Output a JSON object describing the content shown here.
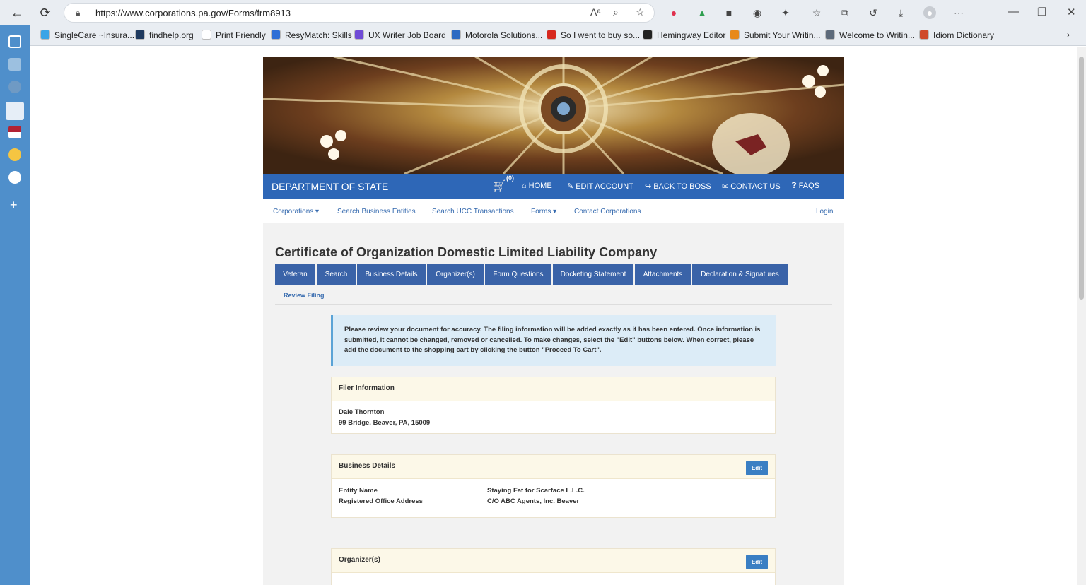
{
  "browser": {
    "url": "https://www.corporations.pa.gov/Forms/frm8913",
    "bookmarks": [
      {
        "label": "SingleCare ~Insura...",
        "color": "#3ba4e6"
      },
      {
        "label": "findhelp.org",
        "color": "#1f3a5f"
      },
      {
        "label": "Print Friendly",
        "color": "#ffffff"
      },
      {
        "label": "ResyMatch: Skills",
        "color": "#2f6fd6"
      },
      {
        "label": "UX Writer Job Board",
        "color": "#6f4bd6"
      },
      {
        "label": "Motorola Solutions...",
        "color": "#2d6ac2"
      },
      {
        "label": "So I went to buy so...",
        "color": "#d7281e"
      },
      {
        "label": "Hemingway Editor",
        "color": "#222222"
      },
      {
        "label": "Submit Your Writin...",
        "color": "#e8891a"
      },
      {
        "label": "Welcome to Writin...",
        "color": "#5d6a7a"
      },
      {
        "label": "Idiom Dictionary",
        "color": "#cf4a2a"
      }
    ]
  },
  "site": {
    "dept_title": "DEPARTMENT OF STATE",
    "cart_count": "(0)",
    "top_nav": [
      "HOME",
      "EDIT ACCOUNT",
      "BACK TO BOSS",
      "CONTACT US",
      "FAQS"
    ],
    "sub_nav": [
      "Corporations",
      "Search Business Entities",
      "Search UCC Transactions",
      "Forms",
      "Contact Corporations"
    ],
    "login": "Login"
  },
  "form": {
    "title": "Certificate of Organization Domestic Limited Liability Company",
    "tabs": [
      "Veteran",
      "Search",
      "Business Details",
      "Organizer(s)",
      "Form Questions",
      "Docketing Statement",
      "Attachments",
      "Declaration & Signatures"
    ],
    "review_tab": "Review Filing",
    "notice": "Please review your document for accuracy. The filing information will be added exactly as it has been entered. Once information is submitted, it cannot be changed, removed or cancelled. To make changes, select the \"Edit\" buttons below. When correct, please add the document to the shopping cart by clicking the button \"Proceed To Cart\".",
    "filer": {
      "header": "Filer Information",
      "name": "Dale Thornton",
      "address": "99 Bridge, Beaver, PA, 15009"
    },
    "business": {
      "header": "Business Details",
      "edit_label": "Edit",
      "entity_name_label": "Entity Name",
      "entity_name": "Staying Fat for Scarface L.L.C.",
      "office_label": "Registered Office Address",
      "office": "C/O ABC Agents, Inc. Beaver"
    },
    "organizers": {
      "header": "Organizer(s)",
      "edit_label": "Edit"
    }
  }
}
